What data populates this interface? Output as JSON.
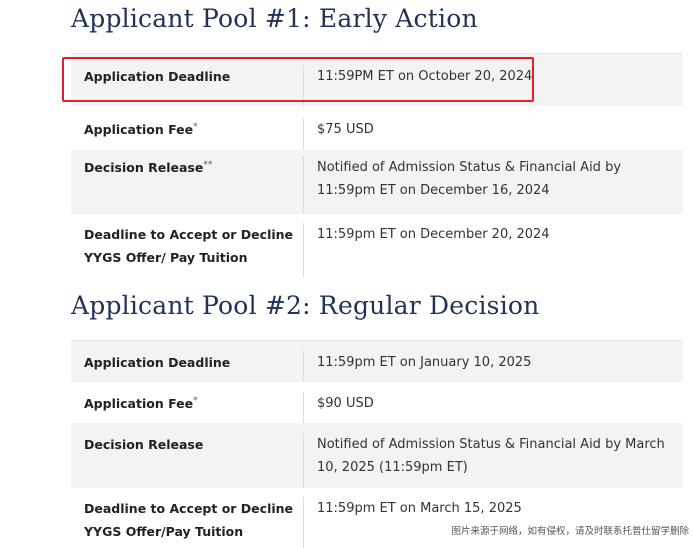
{
  "pool1": {
    "title": "Applicant Pool #1: Early Action",
    "rows": [
      {
        "label": "Application Deadline",
        "star": "",
        "value": "11:59PM ET on October 20, 2024"
      },
      {
        "label": "Application Fee",
        "star": "*",
        "value": "$75 USD"
      },
      {
        "label": "Decision Release",
        "star": "**",
        "value": "Notified of Admission Status & Financial Aid by 11:59pm ET on December 16, 2024"
      },
      {
        "label": "Deadline to Accept or Decline YYGS Offer/ Pay Tuition",
        "star": "",
        "value": "11:59pm ET on December 20, 2024"
      }
    ]
  },
  "pool2": {
    "title": "Applicant Pool #2: Regular Decision",
    "rows": [
      {
        "label": "Application Deadline",
        "star": "",
        "value": "11:59pm ET on January 10, 2025"
      },
      {
        "label": "Application Fee",
        "star": "*",
        "value": "$90 USD"
      },
      {
        "label": "Decision Release",
        "star": "",
        "value": "Notified of Admission Status & Financial Aid by March 10, 2025 (11:59pm ET)"
      },
      {
        "label": "Deadline to Accept or Decline YYGS Offer/Pay Tuition",
        "star": "",
        "value": "11:59pm ET on March 15, 2025"
      }
    ]
  },
  "watermark": "图片来源于网络，如有侵权，请及时联系托普仕留学删除",
  "colors": {
    "title": "#22335a",
    "highlight": "#e0202a",
    "shaded_row": "#f3f3f3"
  }
}
